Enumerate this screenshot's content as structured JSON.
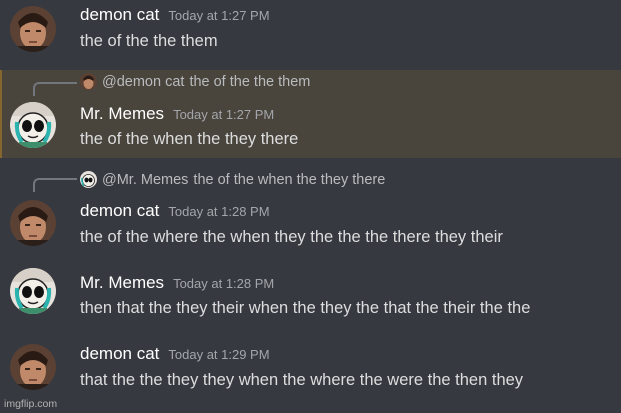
{
  "messages": [
    {
      "username": "demon cat",
      "timestamp": "Today at 1:27 PM",
      "content": "the of the the them",
      "avatar_icon": "demon-cat-avatar"
    },
    {
      "reply": {
        "username": "@demon cat",
        "content": "the of the the them"
      },
      "username": "Mr. Memes",
      "timestamp": "Today at 1:27 PM",
      "content": "the of the when the they there",
      "avatar_icon": "mr-memes-avatar",
      "highlighted": true
    },
    {
      "reply": {
        "username": "@Mr. Memes",
        "content": "the of the when the they there"
      },
      "username": "demon cat",
      "timestamp": "Today at 1:28 PM",
      "content": "the of the where the when they the the the there they their",
      "avatar_icon": "demon-cat-avatar"
    },
    {
      "username": "Mr. Memes",
      "timestamp": "Today at 1:28 PM",
      "content": "then that the they their when the they the that the their the the",
      "avatar_icon": "mr-memes-avatar"
    },
    {
      "username": "demon cat",
      "timestamp": "Today at 1:29 PM",
      "content": "that the the they they when the where the were the then they",
      "avatar_icon": "demon-cat-avatar"
    }
  ],
  "watermark": "imgflip.com",
  "colors": {
    "background": "#36393f",
    "highlight_background": "#49443c",
    "username": "#ffffff",
    "timestamp": "#a3a6aa",
    "message_text": "#dcddde",
    "reply_text": "#b9bbbe"
  }
}
